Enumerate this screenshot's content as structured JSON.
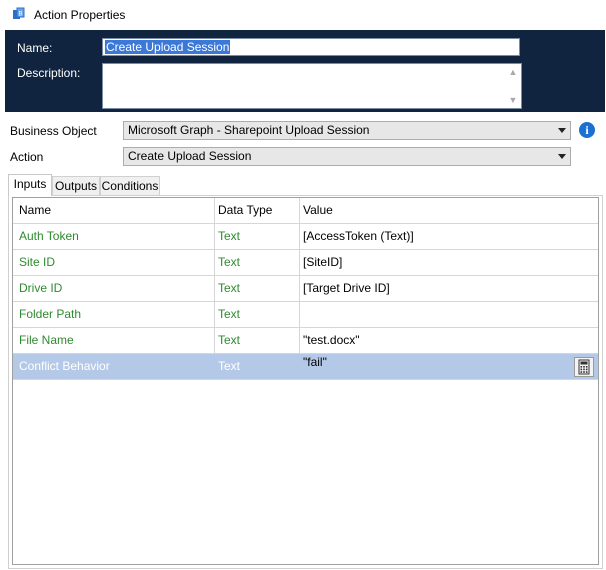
{
  "window": {
    "title": "Action Properties",
    "icon": "action-properties-icon"
  },
  "header": {
    "name_label": "Name:",
    "name_value": "Create Upload Session",
    "description_label": "Description:",
    "description_value": ""
  },
  "business_object": {
    "label": "Business Object",
    "value": "Microsoft Graph - Sharepoint Upload Session",
    "info_icon": "info-icon"
  },
  "action": {
    "label": "Action",
    "value": "Create Upload Session"
  },
  "tabs": [
    {
      "label": "Inputs"
    },
    {
      "label": "Outputs"
    },
    {
      "label": "Conditions"
    }
  ],
  "grid": {
    "columns": [
      "Name",
      "Data Type",
      "Value"
    ],
    "rows": [
      {
        "name": "Auth Token",
        "type": "Text",
        "value": "[AccessToken (Text)]"
      },
      {
        "name": "Site ID",
        "type": "Text",
        "value": "[SiteID]"
      },
      {
        "name": "Drive ID",
        "type": "Text",
        "value": "[Target Drive ID]"
      },
      {
        "name": "Folder Path",
        "type": "Text",
        "value": ""
      },
      {
        "name": "File Name",
        "type": "Text",
        "value": "\"test.docx\""
      },
      {
        "name": "Conflict Behavior",
        "type": "Text",
        "value": "\"fail\""
      }
    ]
  },
  "colors": {
    "header_bg": "#10233f",
    "green_text": "#2f8a2f",
    "selected_row": "#b4c8e8",
    "info_blue": "#1e6fd2"
  }
}
